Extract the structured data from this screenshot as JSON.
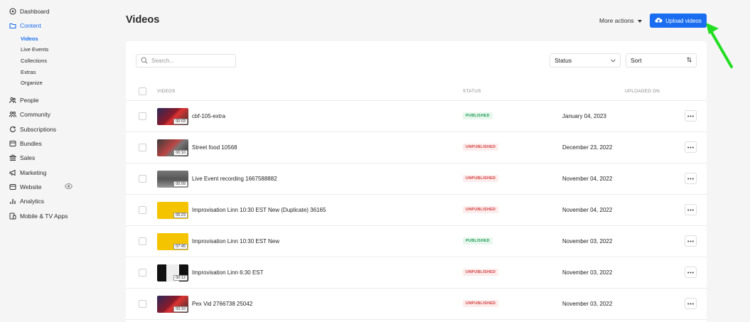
{
  "sidebar": {
    "dashboard": "Dashboard",
    "content": "Content",
    "content_items": [
      "Videos",
      "Live Events",
      "Collections",
      "Extras",
      "Organize"
    ],
    "people": "People",
    "community": "Community",
    "subscriptions": "Subscriptions",
    "bundles": "Bundles",
    "sales": "Sales",
    "marketing": "Marketing",
    "website": "Website",
    "analytics": "Analytics",
    "apps": "Mobile & TV Apps"
  },
  "header": {
    "title": "Videos",
    "more_actions": "More actions",
    "upload": "Upload videos"
  },
  "filters": {
    "search_placeholder": "Search...",
    "status": "Status",
    "sort": "Sort"
  },
  "table": {
    "columns": [
      "VIDEOS",
      "STATUS",
      "UPLOADED ON"
    ],
    "rows": [
      {
        "name": "cbf-105-extra",
        "duration": "00:03",
        "status": "PUBLISHED",
        "date": "January 04, 2023"
      },
      {
        "name": "Street food 10568",
        "duration": "00:10",
        "status": "UNPUBLISHED",
        "date": "December 23, 2022"
      },
      {
        "name": "Live Event recording 1667588882",
        "duration": "00:09",
        "status": "UNPUBLISHED",
        "date": "November 04, 2022"
      },
      {
        "name": "Improvisation Linn 10:30 EST New (Duplicate) 36165",
        "duration": "05:23",
        "status": "UNPUBLISHED",
        "date": "November 04, 2022"
      },
      {
        "name": "Improvisation Linn 10:30 EST New",
        "duration": "07:45",
        "status": "PUBLISHED",
        "date": "November 03, 2022"
      },
      {
        "name": "Improvisation Linn 6:30 EST",
        "duration": "00:12",
        "status": "UNPUBLISHED",
        "date": "November 03, 2022"
      },
      {
        "name": "Pex Vid 2766738 25042",
        "duration": "00:10",
        "status": "UNPUBLISHED",
        "date": "November 03, 2022"
      }
    ]
  },
  "colors": {
    "accent": "#1a6df0",
    "published": "#1e9b53",
    "unpublished": "#d23b3b",
    "annotation_arrow": "#22dd22"
  }
}
